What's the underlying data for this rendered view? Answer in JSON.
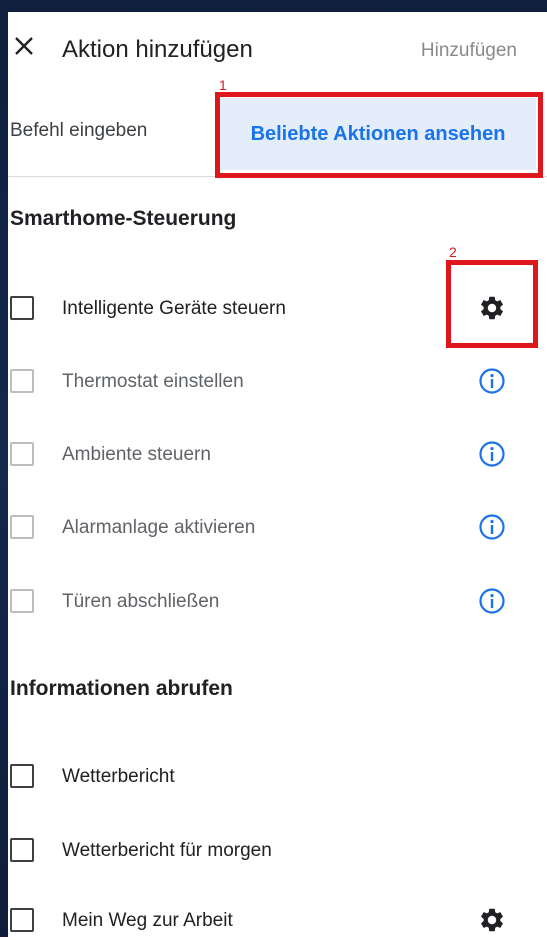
{
  "header": {
    "title": "Aktion hinzufügen",
    "action_label": "Hinzufügen"
  },
  "tabs": [
    {
      "label": "Befehl eingeben"
    },
    {
      "label": "Beliebte Aktionen ansehen"
    }
  ],
  "annotations": {
    "n1": "1",
    "n2": "2"
  },
  "sections": [
    {
      "title": "Smarthome-Steuerung",
      "items": [
        {
          "label": "Intelligente Geräte steuern",
          "icon": "gear-icon"
        },
        {
          "label": "Thermostat einstellen",
          "icon": "info-icon"
        },
        {
          "label": "Ambiente steuern",
          "icon": "info-icon"
        },
        {
          "label": "Alarmanlage aktivieren",
          "icon": "info-icon"
        },
        {
          "label": "Türen abschließen",
          "icon": "info-icon"
        }
      ]
    },
    {
      "title": "Informationen abrufen",
      "items": [
        {
          "label": "Wetterbericht"
        },
        {
          "label": "Wetterbericht für morgen"
        },
        {
          "label": "Mein Weg zur Arbeit",
          "icon": "gear-icon"
        }
      ]
    }
  ],
  "colors": {
    "accent": "#1a73e8",
    "annotation": "#e0161d",
    "tab_selected_bg": "#e4edfa"
  }
}
